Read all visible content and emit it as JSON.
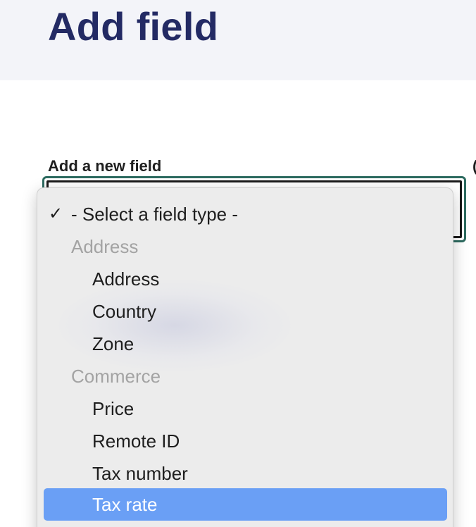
{
  "page": {
    "title": "Add field"
  },
  "form": {
    "label": "Add a new field",
    "edge_label": "("
  },
  "dropdown": {
    "selected_option": "- Select a field type -",
    "check_icon": "✓",
    "groups": [
      {
        "label": "Address",
        "options": [
          "Address",
          "Country",
          "Zone"
        ]
      },
      {
        "label": "Commerce",
        "options": [
          "Price",
          "Remote ID",
          "Tax number",
          "Tax rate"
        ]
      }
    ],
    "highlighted_option": "Tax rate"
  },
  "colors": {
    "title": "#232a64",
    "header_bg": "#f3f4f9",
    "focus_ring": "#2d6b60",
    "highlight": "#6a9ff5",
    "group_label": "#a3a3a3"
  }
}
